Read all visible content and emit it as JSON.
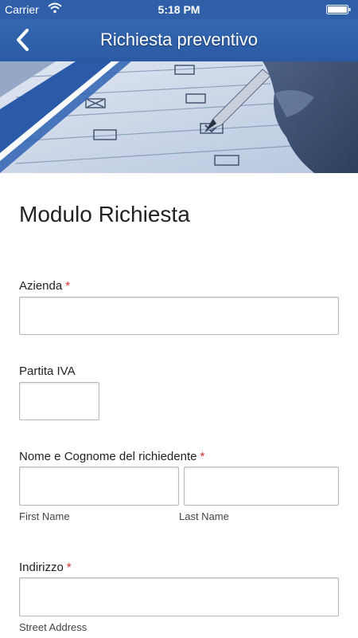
{
  "status_bar": {
    "carrier": "Carrier",
    "time": "5:18 PM",
    "icons": [
      "wifi-icon",
      "battery-icon"
    ]
  },
  "nav_bar": {
    "title": "Richiesta preventivo",
    "back_icon": "chevron-left-icon",
    "color": "#2f5fa8"
  },
  "form": {
    "title": "Modulo Richiesta",
    "required_marker": "*",
    "required_color": "#d32f2f",
    "fields": {
      "azienda": {
        "label": "Azienda",
        "value": ""
      },
      "partita_iva": {
        "label": "Partita IVA",
        "value": ""
      },
      "nome": {
        "label": "Nome e Cognome del richiedente",
        "first_sublabel": "First Name",
        "last_sublabel": "Last Name",
        "first_value": "",
        "last_value": ""
      },
      "indirizzo": {
        "label": "Indirizzo",
        "sublabel": "Street Address",
        "value": ""
      }
    }
  }
}
